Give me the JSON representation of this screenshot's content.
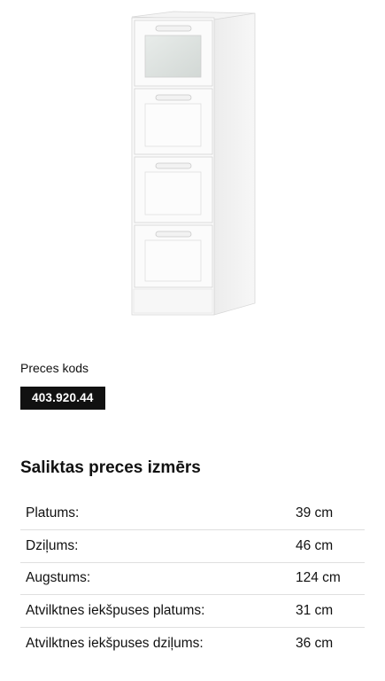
{
  "product": {
    "code_label": "Preces kods",
    "code_value": "403.920.44"
  },
  "dimensions": {
    "title": "Saliktas preces izmērs",
    "rows": [
      {
        "name": "Platums:",
        "value": "39 cm"
      },
      {
        "name": "Dziļums:",
        "value": "46 cm"
      },
      {
        "name": "Augstums:",
        "value": "124 cm"
      },
      {
        "name": "Atvilktnes iekšpuses platums:",
        "value": "31 cm"
      },
      {
        "name": "Atvilktnes iekšpuses dziļums:",
        "value": "36 cm"
      }
    ]
  },
  "colors": {
    "badge_background": "#111111",
    "badge_text": "#ffffff",
    "divider": "#dfdfdf"
  }
}
